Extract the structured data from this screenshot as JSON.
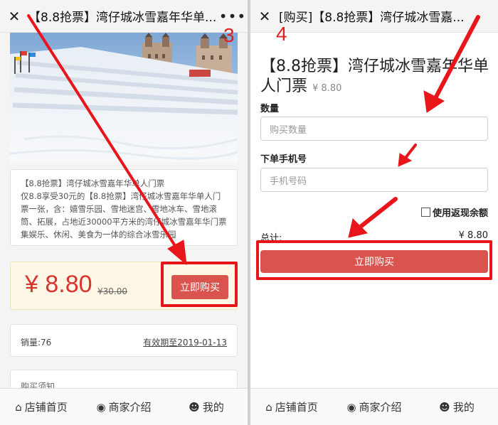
{
  "left": {
    "close_icon": "close-icon",
    "title": "【8.8抢票】湾仔城冰雪嘉年华单...",
    "more_icon": "more-icon",
    "step": "3",
    "description": {
      "line1": "【8.8抢票】湾仔城冰雪嘉年华单人门票",
      "line2": "仅8.8享受30元的【8.8抢票】湾仔城冰雪嘉年华单人门",
      "line3": "票一张，含：嬉雪乐园、雪地迷宫、雪地冰车、雪地滚",
      "line4": "筒、拓展，占地近30000平方米的湾仔城冰雪嘉年华门票",
      "line5": "集娱乐、休闲、美食为一体的综合冰雪乐园"
    },
    "price": "¥ 8.80",
    "old_price": "¥30.00",
    "buy_button": "立即购买",
    "sales": "销量:76",
    "expiry": "有效期至2019-01-13",
    "notice": "购买须知"
  },
  "right": {
    "close_icon": "close-icon",
    "title": "[购买]【8.8抢票】湾仔城冰雪嘉...",
    "step": "4",
    "product_title": "【8.8抢票】湾仔城冰雪嘉年华单人门票",
    "product_price": "¥ 8.80",
    "quantity_label": "数量",
    "quantity_placeholder": "购买数量",
    "phone_label": "下单手机号",
    "phone_placeholder": "手机号码",
    "rebate_label": "使用返现余额",
    "total_label": "总计:",
    "total_value": "¥ 8.80",
    "buy_button": "立即购买"
  },
  "tabbar": {
    "home": {
      "icon": "home-icon",
      "label": "店铺首页"
    },
    "merchant": {
      "icon": "eye-icon",
      "label": "商家介绍"
    },
    "mine": {
      "icon": "user-icon",
      "label": "我的"
    }
  },
  "colors": {
    "accent_red": "#d9534f",
    "price_red": "#d9352e",
    "annotation_red": "#e8151b",
    "price_box_bg": "#fff8e6"
  }
}
